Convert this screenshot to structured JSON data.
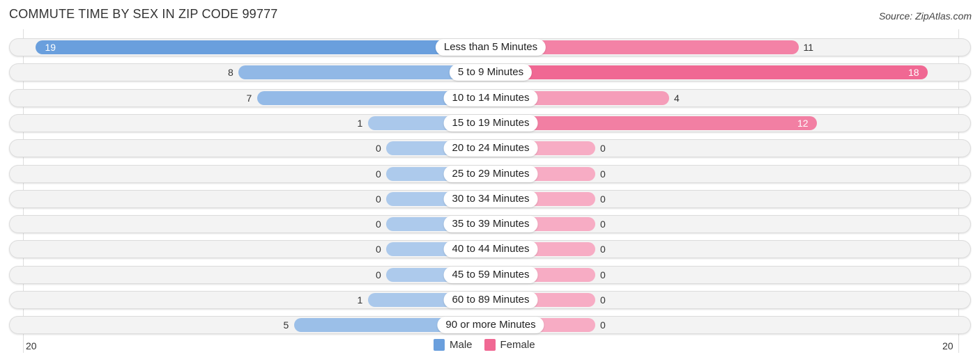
{
  "title": "COMMUTE TIME BY SEX IN ZIP CODE 99777",
  "source": "Source: ZipAtlas.com",
  "colors": {
    "male": "#6a9fdd",
    "female": "#f06893",
    "male_light": "#a9c8ea",
    "female_light": "#f6a8c2"
  },
  "legend": {
    "male_label": "Male",
    "female_label": "Female"
  },
  "axis": {
    "left_tick": "20",
    "right_tick": "20"
  },
  "chart_data": {
    "type": "bar",
    "orientation": "horizontal-diverging",
    "title": "COMMUTE TIME BY SEX IN ZIP CODE 99777",
    "categories": [
      "Less than 5 Minutes",
      "5 to 9 Minutes",
      "10 to 14 Minutes",
      "15 to 19 Minutes",
      "20 to 24 Minutes",
      "25 to 29 Minutes",
      "30 to 34 Minutes",
      "35 to 39 Minutes",
      "40 to 44 Minutes",
      "45 to 59 Minutes",
      "60 to 89 Minutes",
      "90 or more Minutes"
    ],
    "series": [
      {
        "name": "Male",
        "values": [
          19,
          8,
          7,
          1,
          0,
          0,
          0,
          0,
          0,
          0,
          1,
          5
        ]
      },
      {
        "name": "Female",
        "values": [
          11,
          18,
          4,
          12,
          0,
          0,
          0,
          0,
          0,
          0,
          0,
          0
        ]
      }
    ],
    "xlim": [
      -20,
      20
    ],
    "xtick_labels": [
      "20",
      "20"
    ],
    "legend": [
      "Male",
      "Female"
    ],
    "legend_position": "bottom-center"
  }
}
